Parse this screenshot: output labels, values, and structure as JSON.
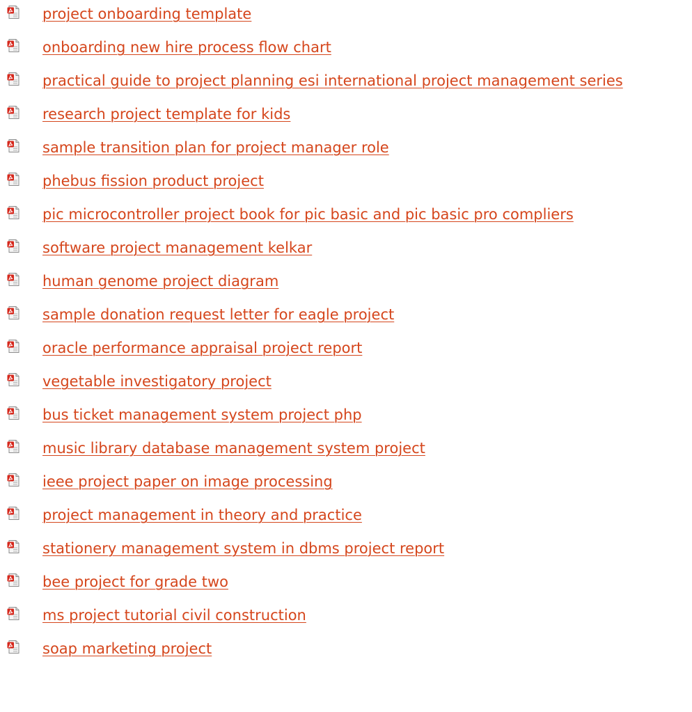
{
  "accent_color": "#d5461c",
  "icon": "pdf-file-icon",
  "links": [
    {
      "label": "project onboarding template"
    },
    {
      "label": "onboarding new hire process flow chart"
    },
    {
      "label": "practical guide to project planning esi international project management series"
    },
    {
      "label": "research project template for kids"
    },
    {
      "label": "sample transition plan for project manager role"
    },
    {
      "label": "phebus fission product project"
    },
    {
      "label": "pic microcontroller project book for pic basic and pic basic pro compliers"
    },
    {
      "label": "software project management kelkar"
    },
    {
      "label": "human genome project diagram"
    },
    {
      "label": "sample donation request letter for eagle project"
    },
    {
      "label": "oracle performance appraisal project report"
    },
    {
      "label": "vegetable investigatory project"
    },
    {
      "label": "bus ticket management system project php"
    },
    {
      "label": "music library database management system project"
    },
    {
      "label": "ieee project paper on image processing"
    },
    {
      "label": "project management in theory and practice"
    },
    {
      "label": "stationery management system in dbms project report"
    },
    {
      "label": "bee project for grade two"
    },
    {
      "label": "ms project tutorial civil construction"
    },
    {
      "label": "soap marketing project"
    }
  ]
}
